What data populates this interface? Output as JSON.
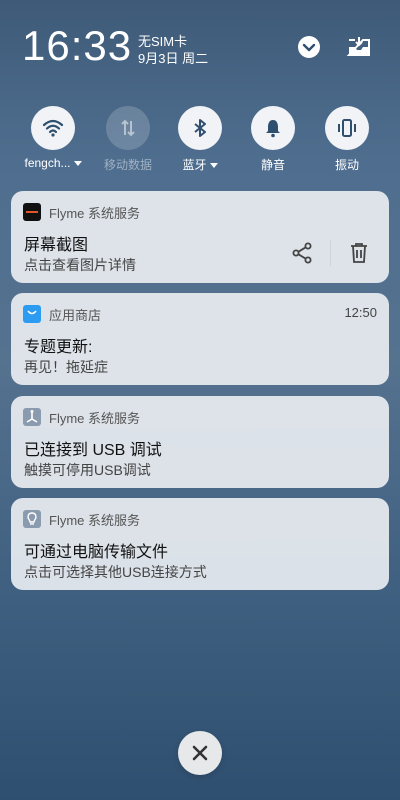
{
  "status": {
    "time": "16:33",
    "carrier": "无SIM卡",
    "date": "9月3日 周二"
  },
  "toggles": [
    {
      "label": "fengch...",
      "icon": "wifi-icon",
      "active": true
    },
    {
      "label": "移动数据",
      "icon": "mobile-data-icon",
      "active": false
    },
    {
      "label": "蓝牙",
      "icon": "bluetooth-icon",
      "active": true
    },
    {
      "label": "静音",
      "icon": "bell-icon",
      "active": true
    },
    {
      "label": "振动",
      "icon": "vibrate-icon",
      "active": true
    }
  ],
  "notifications": [
    {
      "app": "Flyme 系统服务",
      "title": "屏幕截图",
      "body": "点击查看图片详情",
      "time": "",
      "icon": "screenshot-thumb-icon"
    },
    {
      "app": "应用商店",
      "title": "专题更新:",
      "body": "再见！拖延症",
      "time": "12:50",
      "icon": "app-store-bag-icon"
    },
    {
      "app": "Flyme 系统服务",
      "title": "已连接到 USB 调试",
      "body": "触摸可停用USB调试",
      "time": "",
      "icon": "usb-icon"
    },
    {
      "app": "Flyme 系统服务",
      "title": "可通过电脑传输文件",
      "body": "点击可选择其他USB连接方式",
      "time": "",
      "icon": "bulb-icon"
    }
  ],
  "colors": {
    "accent_dark": "#2f4f6f",
    "card_bg": "#eceff3",
    "store_blue": "#2b9cf2"
  }
}
